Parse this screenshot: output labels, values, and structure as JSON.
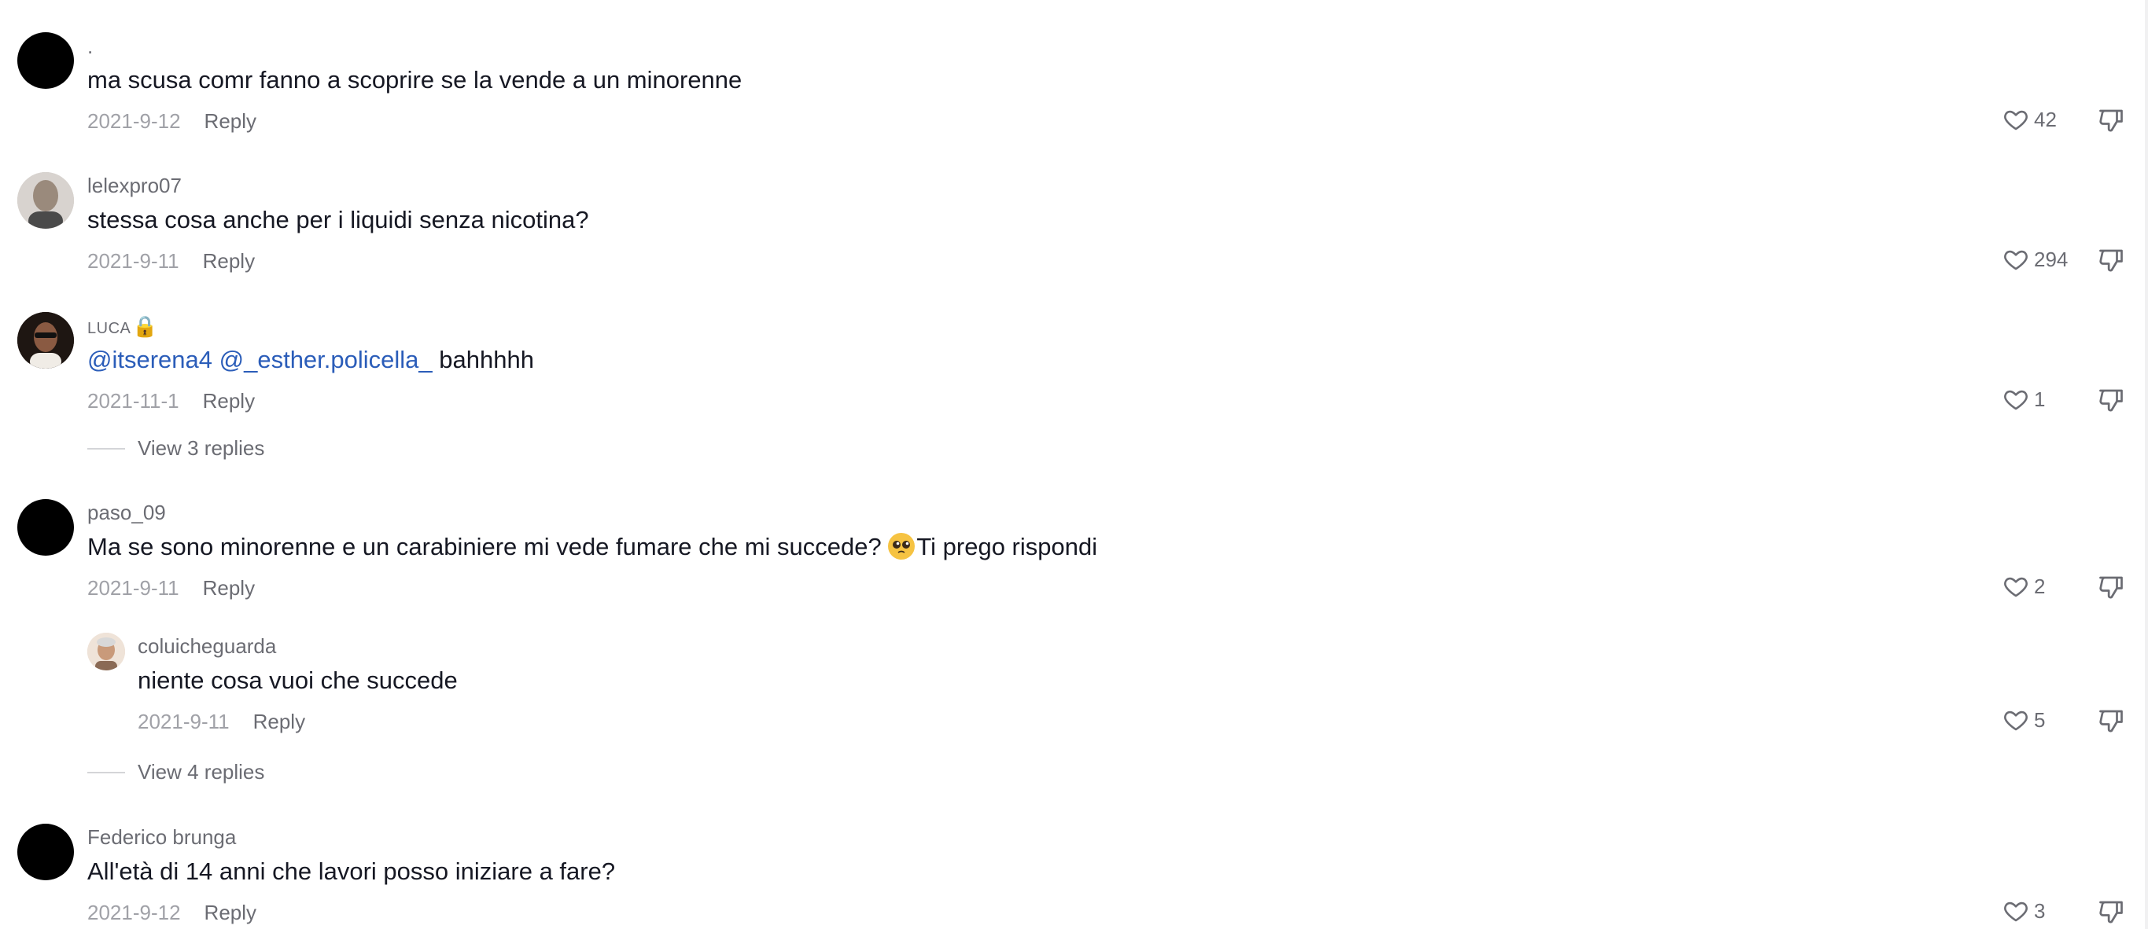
{
  "comments": [
    {
      "username": ".",
      "text": "ma scusa comr fanno a scoprire se la vende a un minorenne",
      "date": "2021-9-12",
      "reply_label": "Reply",
      "likes": "42"
    },
    {
      "username": "lelexpro07",
      "text": "stessa cosa anche per i liquidi senza nicotina?",
      "date": "2021-9-11",
      "reply_label": "Reply",
      "likes": "294"
    },
    {
      "username": "LUCA",
      "username_emoji": "🔒",
      "mention_1": "@itserena4",
      "mention_2": "@_esther.policella_",
      "text": "bahhhhh",
      "date": "2021-11-1",
      "reply_label": "Reply",
      "likes": "1",
      "view_replies": "View 3 replies"
    },
    {
      "username": "paso_09",
      "text_before": "Ma se sono minorenne e un carabiniere mi vede fumare che mi succede? ",
      "emoji": "pleading-face",
      "text_after": "Ti prego rispondi",
      "date": "2021-9-11",
      "reply_label": "Reply",
      "likes": "2",
      "reply": {
        "username": "coluicheguarda",
        "text": "niente cosa vuoi che succede",
        "date": "2021-9-11",
        "reply_label": "Reply",
        "likes": "5"
      },
      "view_replies": "View 4 replies"
    },
    {
      "username": "Federico brunga",
      "text": "All'età di 14 anni che lavori posso iniziare a fare?",
      "date": "2021-9-12",
      "reply_label": "Reply",
      "likes": "3"
    }
  ],
  "icons": {
    "like": "heart-outline-icon",
    "dislike": "thumbs-down-icon"
  },
  "colors": {
    "mention": "#2b5db9",
    "username": "#6b6c73",
    "date": "#a0a1a7",
    "text": "#161823"
  }
}
